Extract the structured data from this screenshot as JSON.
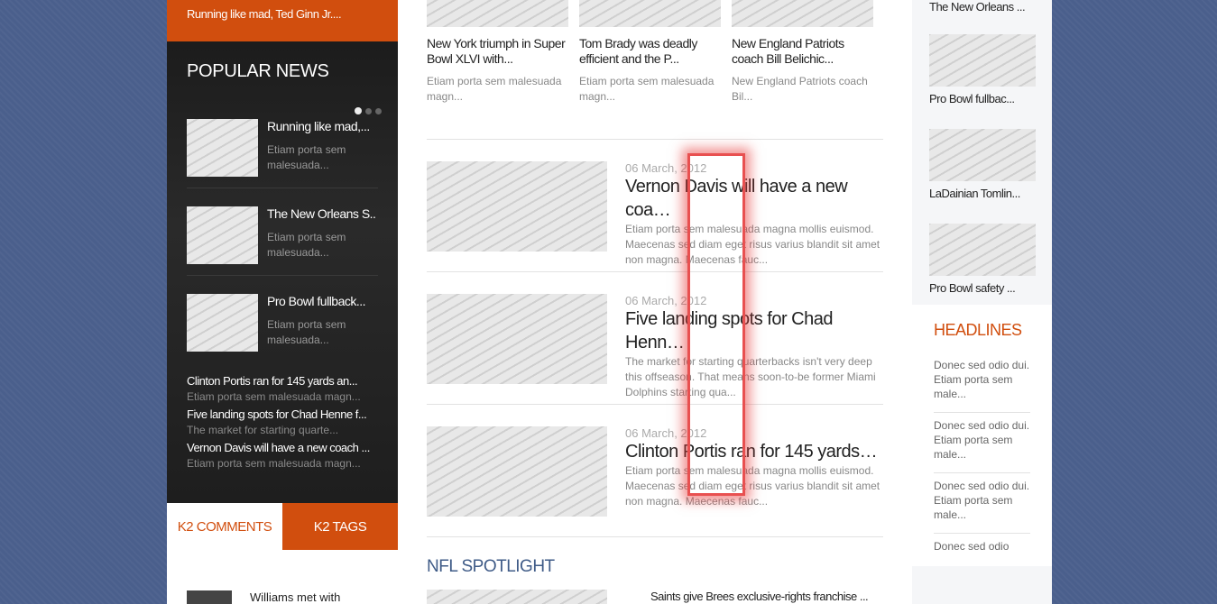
{
  "left": {
    "top_link": "Running like mad, Ted Ginn Jr....",
    "popular": {
      "title": "POPULAR NEWS",
      "items": [
        {
          "title": "Running like mad,...",
          "excerpt": "Etiam porta sem malesuada..."
        },
        {
          "title": "The New Orleans S...",
          "excerpt": "Etiam porta sem malesuada..."
        },
        {
          "title": "Pro Bowl fullback...",
          "excerpt": "Etiam porta sem malesuada..."
        }
      ],
      "links": [
        {
          "title": "Clinton Portis ran for 145 yards an...",
          "excerpt": "Etiam porta sem malesuada magn..."
        },
        {
          "title": "Five landing spots for Chad Henne f...",
          "excerpt": "The market for starting quarte..."
        },
        {
          "title": "Vernon Davis will have a new coach ...",
          "excerpt": "Etiam porta sem malesuada magn..."
        }
      ]
    },
    "tabs": {
      "comments": "K2 COMMENTS",
      "tags": "K2 TAGS"
    },
    "comment": "Williams met with"
  },
  "center": {
    "top_articles": [
      {
        "title": "New York triumph in Super Bowl XLVI with...",
        "excerpt": "Etiam porta sem malesuada magn..."
      },
      {
        "title": "Tom Brady was deadly efficient and the P...",
        "excerpt": "Etiam porta sem malesuada magn..."
      },
      {
        "title": "New England Patriots coach Bill Belichic...",
        "excerpt": "New England Patriots coach Bil..."
      }
    ],
    "articles": [
      {
        "date": "06 March, 2012",
        "title": "Vernon Davis will have a new coa…",
        "excerpt": "Etiam porta sem malesuada magna mollis euismod. Maecenas sed diam eget risus varius blandit sit amet non magna. Maecenas fauc..."
      },
      {
        "date": "06 March, 2012",
        "title": "Five landing spots for Chad Henn…",
        "excerpt": "The market for starting quarterbacks isn't very deep this offseason. That means soon-to-be former Miami Dolphins starting qua..."
      },
      {
        "date": "06 March, 2012",
        "title": "Clinton Portis ran for 145 yards…",
        "excerpt": "Etiam porta sem malesuada magna mollis euismod. Maecenas sed diam eget risus varius blandit sit amet non magna. Maecenas fauc..."
      }
    ],
    "nfl_title": "NFL SPOTLIGHT",
    "nfl_item": "Saints give Brees exclusive-rights franchise ..."
  },
  "right": {
    "items": [
      {
        "title": "The New Orleans ..."
      },
      {
        "title": "Pro Bowl fullbac..."
      },
      {
        "title": "LaDainian Tomlin..."
      },
      {
        "title": "Pro Bowl safety ..."
      }
    ],
    "headlines": {
      "title": "HEADLINES",
      "items": [
        "Donec sed odio dui. Etiam porta sem male...",
        "Donec sed odio dui. Etiam porta sem male...",
        "Donec sed odio dui. Etiam porta sem male...",
        "Donec sed odio"
      ]
    }
  },
  "colors": {
    "accent": "#d14e0e",
    "nfl": "#3f5b87"
  }
}
